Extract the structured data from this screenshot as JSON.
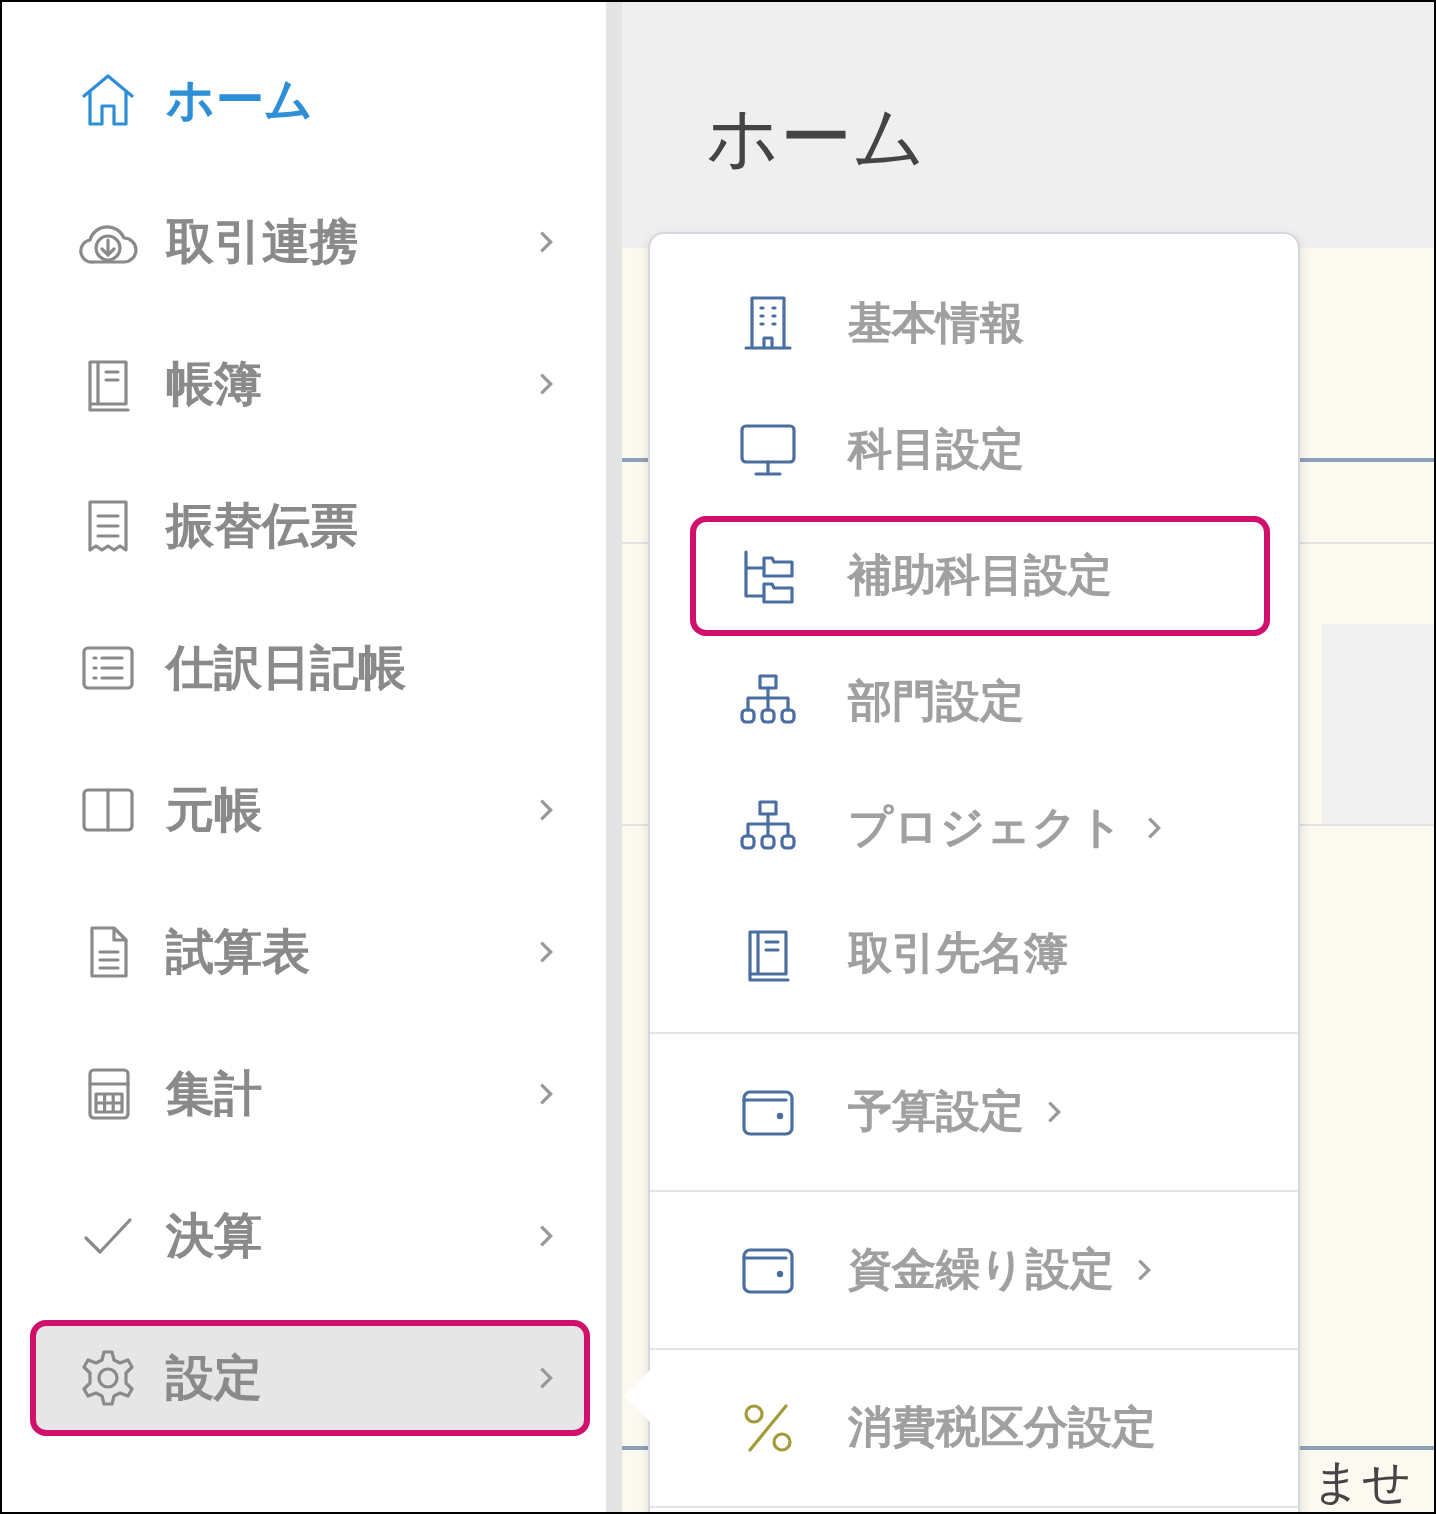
{
  "sidebar": {
    "items": [
      {
        "label": "ホーム",
        "current": true,
        "selected": false,
        "highlighted": false,
        "has_submenu": false
      },
      {
        "label": "取引連携",
        "current": false,
        "selected": false,
        "highlighted": false,
        "has_submenu": true
      },
      {
        "label": "帳簿",
        "current": false,
        "selected": false,
        "highlighted": false,
        "has_submenu": true
      },
      {
        "label": "振替伝票",
        "current": false,
        "selected": false,
        "highlighted": false,
        "has_submenu": false
      },
      {
        "label": "仕訳日記帳",
        "current": false,
        "selected": false,
        "highlighted": false,
        "has_submenu": false
      },
      {
        "label": "元帳",
        "current": false,
        "selected": false,
        "highlighted": false,
        "has_submenu": true
      },
      {
        "label": "試算表",
        "current": false,
        "selected": false,
        "highlighted": false,
        "has_submenu": true
      },
      {
        "label": "集計",
        "current": false,
        "selected": false,
        "highlighted": false,
        "has_submenu": true
      },
      {
        "label": "決算",
        "current": false,
        "selected": false,
        "highlighted": false,
        "has_submenu": true
      },
      {
        "label": "設定",
        "current": false,
        "selected": true,
        "highlighted": true,
        "has_submenu": true
      }
    ]
  },
  "page": {
    "title": "ホーム",
    "note": "ませ"
  },
  "settings_menu": {
    "groups": [
      [
        {
          "label": "基本情報",
          "highlighted": false,
          "has_submenu": false
        },
        {
          "label": "科目設定",
          "highlighted": false,
          "has_submenu": false
        },
        {
          "label": "補助科目設定",
          "highlighted": true,
          "has_submenu": false
        },
        {
          "label": "部門設定",
          "highlighted": false,
          "has_submenu": false
        },
        {
          "label": "プロジェクト",
          "highlighted": false,
          "has_submenu": true
        },
        {
          "label": "取引先名簿",
          "highlighted": false,
          "has_submenu": false
        }
      ],
      [
        {
          "label": "予算設定",
          "highlighted": false,
          "has_submenu": true
        }
      ],
      [
        {
          "label": "資金繰り設定",
          "highlighted": false,
          "has_submenu": true
        }
      ],
      [
        {
          "label": "消費税区分設定",
          "highlighted": false,
          "has_submenu": false
        }
      ]
    ]
  }
}
